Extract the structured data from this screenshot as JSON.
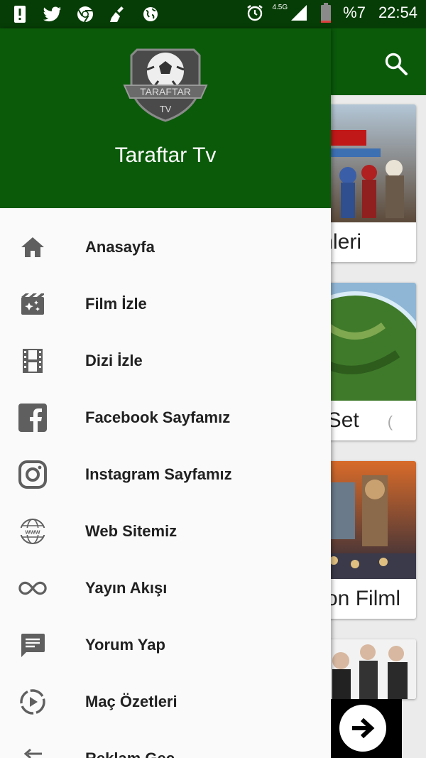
{
  "status_bar": {
    "left_icons": [
      "alert-icon",
      "twitter-icon",
      "chrome-icon",
      "cleaner-icon",
      "globe-icon"
    ],
    "network_label": "4.5G",
    "battery": "%7",
    "time": "22:54"
  },
  "background": {
    "cards": [
      {
        "title": "mleri",
        "image": "marvel-heroes-poster"
      },
      {
        "title": "oSet",
        "extra": "(",
        "image": "planet-poster"
      },
      {
        "title": "yon Filml",
        "image": "fantasy-poster"
      },
      {
        "title": "",
        "image": "people-poster"
      }
    ]
  },
  "drawer": {
    "logo_text": "TARAFTAR",
    "logo_sub": "TV",
    "title": "Taraftar Tv",
    "items": [
      {
        "label": "Anasayfa",
        "icon": "home-icon"
      },
      {
        "label": "Film İzle",
        "icon": "movie-icon"
      },
      {
        "label": "Dizi İzle",
        "icon": "film-strip-icon"
      },
      {
        "label": "Facebook Sayfamız",
        "icon": "facebook-icon"
      },
      {
        "label": "Instagram Sayfamız",
        "icon": "instagram-icon"
      },
      {
        "label": "Web Sitemiz",
        "icon": "www-icon"
      },
      {
        "label": "Yayın Akışı",
        "icon": "infinity-icon"
      },
      {
        "label": "Yorum Yap",
        "icon": "comment-icon"
      },
      {
        "label": "Maç Özetleri",
        "icon": "play-circle-icon"
      },
      {
        "label": "Reklam Geç",
        "icon": "arrow-right-icon"
      }
    ]
  },
  "colors": {
    "status_bar": "#063d06",
    "primary": "#0a5a0a",
    "drawer_bg": "#fafafa",
    "icon_gray": "#5f5f5f"
  }
}
